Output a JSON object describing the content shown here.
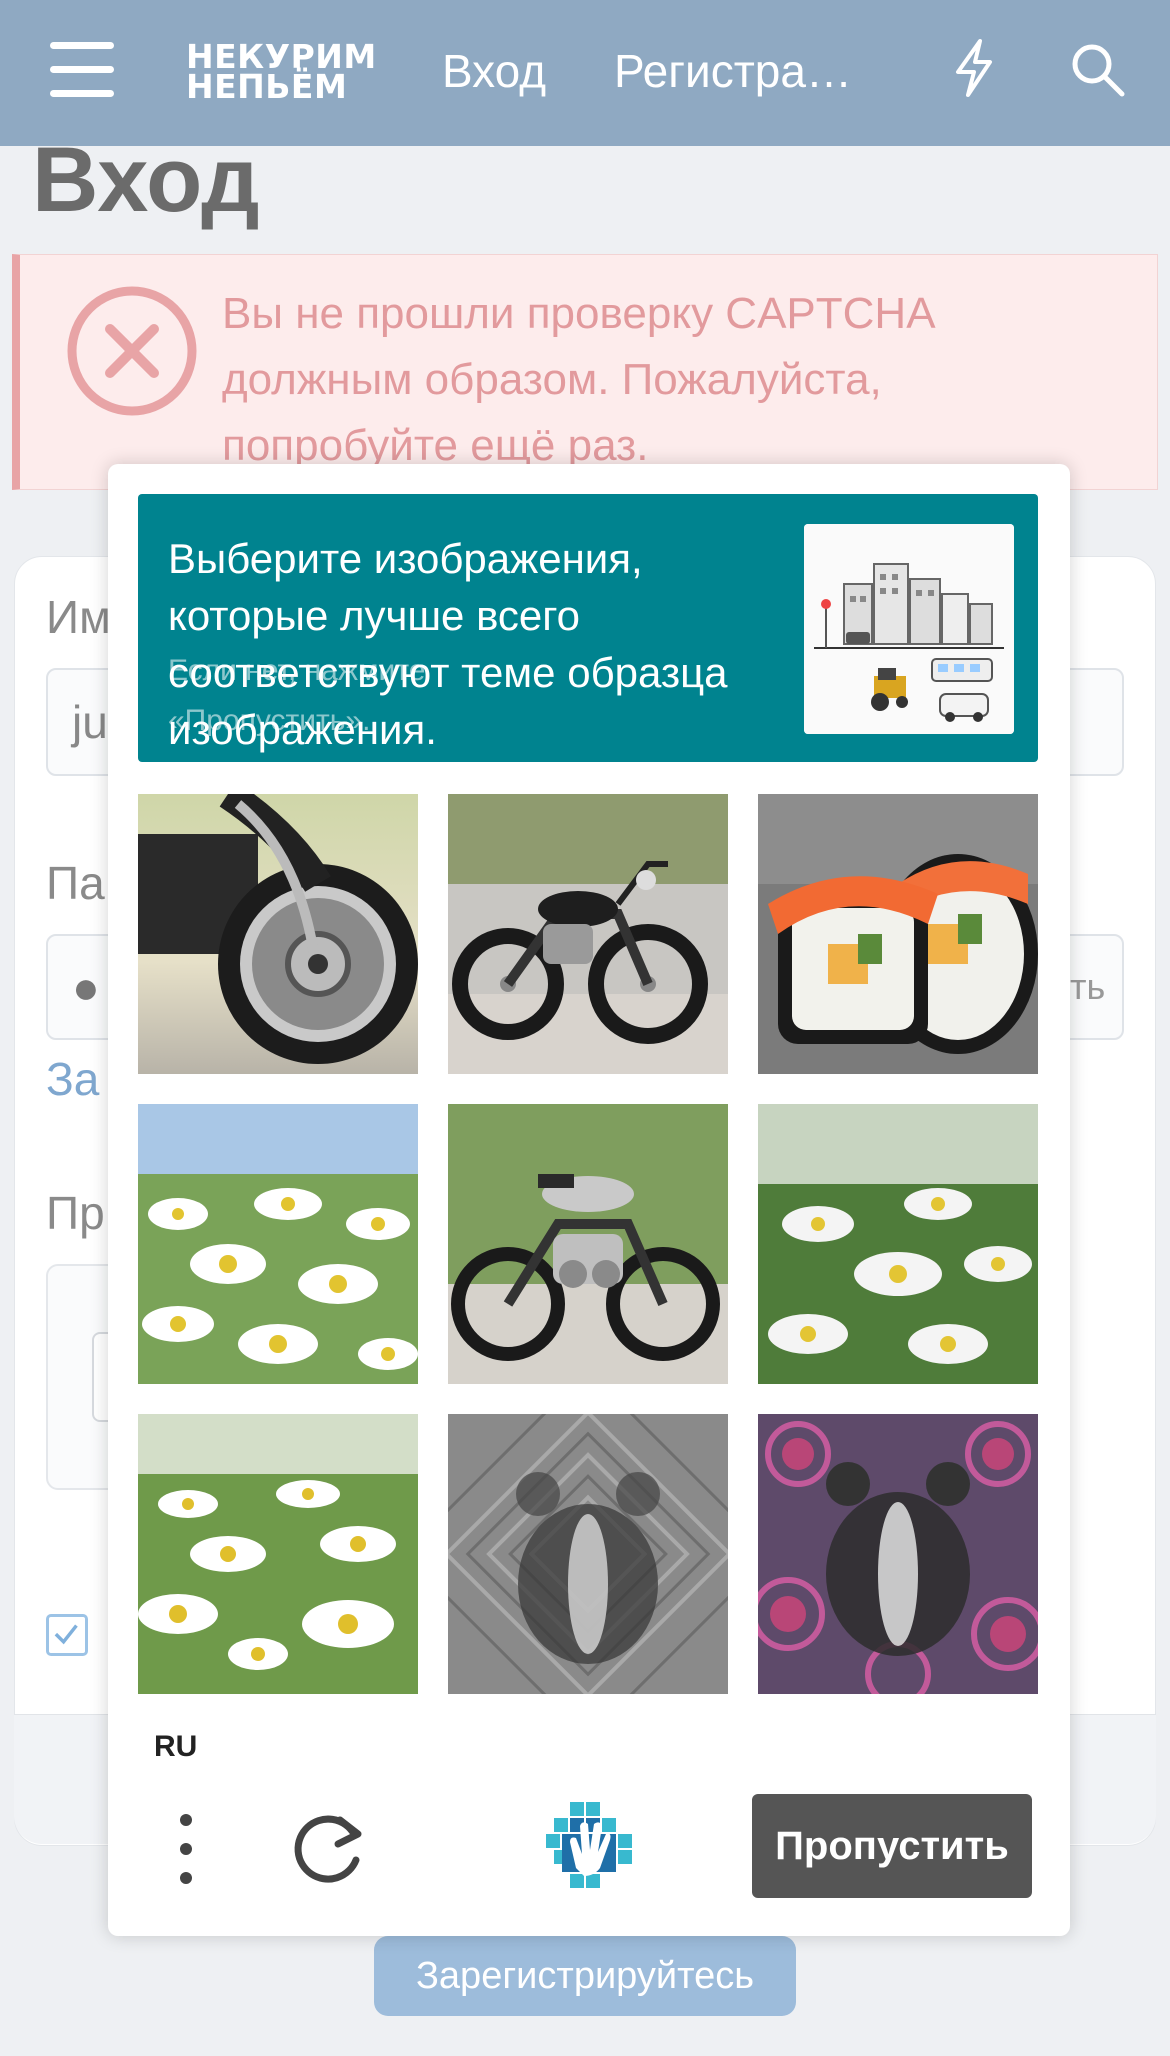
{
  "header": {
    "logo_line1": "НЕКУРИМ",
    "logo_line2": "НЕПЬЁМ",
    "login_label": "Вход",
    "register_label": "Регистра…",
    "icons": [
      "menu-icon",
      "bolt-icon",
      "search-icon"
    ],
    "background_color": "#8fa9c2"
  },
  "page": {
    "title": "Вход",
    "error_message": "Вы не прошли проверку CAPTCHA должным образом. Пожалуйста, попробуйте ещё раз.",
    "form": {
      "username_label": "Им",
      "username_value": "ju",
      "password_label": "Па",
      "password_value": "●",
      "show_password_label": "ть",
      "forgot_link": "За",
      "captcha_label": "Пр"
    },
    "register_button": "Зарегистрируйтесь",
    "error_color": "#e29a9d"
  },
  "captcha": {
    "prompt": "Выберите изображения, которые лучше всего соответствуют теме образца изображения.",
    "hint": "Если нет, нажмите «Пропустить».",
    "header_color": "#00838f",
    "sample_image": "city-transport-illustration",
    "tiles": [
      {
        "content": "motorcycle-closeup"
      },
      {
        "content": "motorcycle"
      },
      {
        "content": "sushi"
      },
      {
        "content": "daisies"
      },
      {
        "content": "motorcycle-side"
      },
      {
        "content": "daisies"
      },
      {
        "content": "daisies"
      },
      {
        "content": "badger-pattern-gray"
      },
      {
        "content": "badger-pattern-pink"
      }
    ],
    "language": "RU",
    "skip_label": "Пропустить",
    "icons": [
      "more-options-icon",
      "refresh-icon",
      "hcaptcha-hand-icon"
    ]
  }
}
